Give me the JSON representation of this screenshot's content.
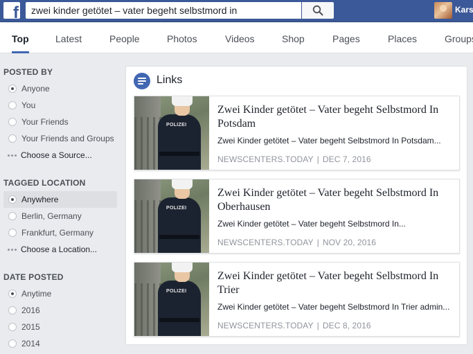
{
  "header": {
    "logo": "f",
    "search_value": "zwei kinder getötet – vater begeht selbstmord in",
    "search_icon": "search-icon",
    "user_name": "Kars"
  },
  "tabs": [
    {
      "label": "Top",
      "active": true
    },
    {
      "label": "Latest"
    },
    {
      "label": "People"
    },
    {
      "label": "Photos"
    },
    {
      "label": "Videos"
    },
    {
      "label": "Shop"
    },
    {
      "label": "Pages"
    },
    {
      "label": "Places"
    },
    {
      "label": "Groups"
    }
  ],
  "filters": {
    "posted_by": {
      "heading": "POSTED BY",
      "options": [
        "Anyone",
        "You",
        "Your Friends",
        "Your Friends and Groups"
      ],
      "selected": "Anyone",
      "choose": "Choose a Source..."
    },
    "tagged_location": {
      "heading": "TAGGED LOCATION",
      "options": [
        "Anywhere",
        "Berlin, Germany",
        "Frankfurt, Germany"
      ],
      "selected": "Anywhere",
      "choose": "Choose a Location..."
    },
    "date_posted": {
      "heading": "DATE POSTED",
      "options": [
        "Anytime",
        "2016",
        "2015",
        "2014"
      ],
      "selected": "Anytime"
    }
  },
  "links_card": {
    "title": "Links",
    "items": [
      {
        "title": "Zwei Kinder getötet – Vater begeht Selbstmord In Potsdam",
        "description": "Zwei Kinder getötet – Vater begeht Selbstmord In Potsdam...",
        "source": "NEWSCENTERS.TODAY",
        "date": "DEC 7, 2016",
        "image_label": "POLIZEI"
      },
      {
        "title": "Zwei Kinder getötet – Vater begeht Selbstmord In Oberhausen",
        "description": "Zwei Kinder getötet – Vater begeht Selbstmord In...",
        "source": "NEWSCENTERS.TODAY",
        "date": "NOV 20, 2016",
        "image_label": "POLIZEI"
      },
      {
        "title": "Zwei Kinder getötet – Vater begeht Selbstmord In Trier",
        "description": "Zwei Kinder getötet – Vater begeht Selbstmord In Trier admin...",
        "source": "NEWSCENTERS.TODAY",
        "date": "DEC 8, 2016",
        "image_label": "POLIZEI"
      }
    ]
  },
  "colors": {
    "brand_blue": "#3b5998",
    "accent": "#4267b2",
    "page_bg": "#e9ebee"
  }
}
